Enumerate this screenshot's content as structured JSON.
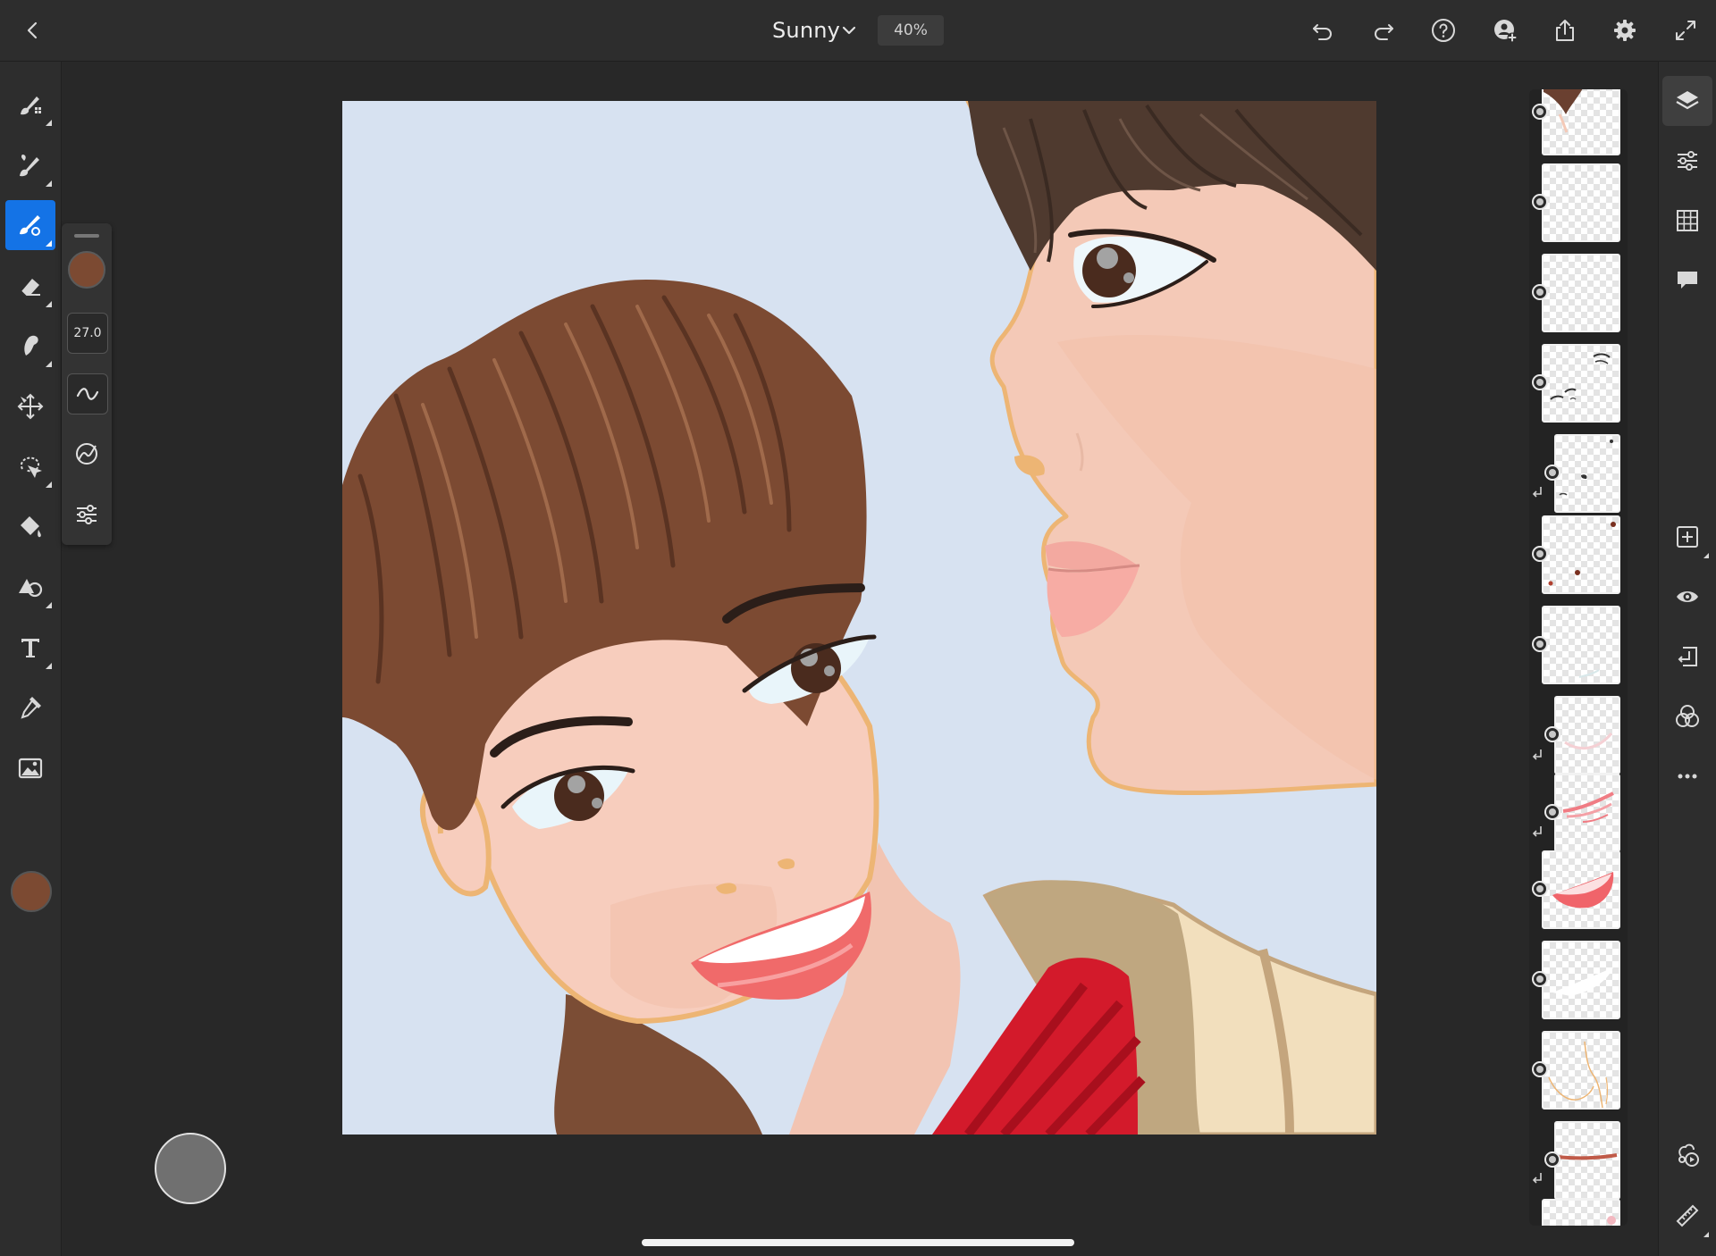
{
  "document": {
    "title": "Sunny",
    "zoom": "40%"
  },
  "topbar": {
    "left_icons": [
      "back-chevron-icon"
    ],
    "title_dropdown_icon": "chevron-down-icon",
    "right_icons": [
      "undo-icon",
      "redo-icon",
      "help-icon",
      "invite-user-icon",
      "share-icon",
      "settings-gear-icon",
      "fullscreen-icon"
    ]
  },
  "left_toolbar": {
    "tools": [
      {
        "id": "pixel-brush",
        "icon": "pixel-brush-icon",
        "active": false
      },
      {
        "id": "live-brush",
        "icon": "live-brush-icon",
        "active": false
      },
      {
        "id": "vector-brush",
        "icon": "vector-brush-icon",
        "active": true
      },
      {
        "id": "eraser",
        "icon": "eraser-icon",
        "active": false
      },
      {
        "id": "smudge",
        "icon": "smudge-icon",
        "active": false
      },
      {
        "id": "transform",
        "icon": "transform-move-icon",
        "active": false
      },
      {
        "id": "lasso-selection",
        "icon": "lasso-icon",
        "active": false
      },
      {
        "id": "fill",
        "icon": "paint-bucket-icon",
        "active": false
      },
      {
        "id": "shapes",
        "icon": "shapes-icon",
        "active": false
      },
      {
        "id": "text",
        "icon": "text-icon",
        "active": false
      },
      {
        "id": "eyedropper",
        "icon": "eyedropper-icon",
        "active": false
      },
      {
        "id": "place-image",
        "icon": "image-icon",
        "active": false
      }
    ],
    "current_color": "#7c4a32"
  },
  "brush_flyout": {
    "color": "#7c4a32",
    "size_value": "27.0",
    "items": [
      "brush-color-swatch",
      "brush-size-field",
      "smoothing-icon",
      "pressure-icon",
      "brush-settings-icon"
    ]
  },
  "right_toolbar": {
    "tools": [
      {
        "id": "layers",
        "icon": "layers-icon",
        "active": true
      },
      {
        "id": "layer-properties",
        "icon": "sliders-icon",
        "active": false
      },
      {
        "id": "grid",
        "icon": "grid-icon",
        "active": false
      },
      {
        "id": "comments",
        "icon": "comment-icon",
        "active": false
      },
      {
        "id": "add-layer",
        "icon": "add-layer-icon",
        "active": false
      },
      {
        "id": "visibility",
        "icon": "eye-icon",
        "active": false
      },
      {
        "id": "merge-down",
        "icon": "merge-down-icon",
        "active": false
      },
      {
        "id": "blend-mode",
        "icon": "blend-mode-icon",
        "active": false
      },
      {
        "id": "more",
        "icon": "more-horizontal-icon",
        "active": false
      },
      {
        "id": "timelapse",
        "icon": "timelapse-icon",
        "active": false
      },
      {
        "id": "ruler",
        "icon": "ruler-icon",
        "active": false
      }
    ]
  },
  "layers": [
    {
      "content": "hair-top",
      "clipped": false
    },
    {
      "content": "empty",
      "clipped": false
    },
    {
      "content": "empty",
      "clipped": false
    },
    {
      "content": "eye-lines",
      "clipped": false
    },
    {
      "content": "small-marks",
      "clipped": true
    },
    {
      "content": "dots",
      "clipped": false
    },
    {
      "content": "empty",
      "clipped": false
    },
    {
      "content": "faint-pink",
      "clipped": true
    },
    {
      "content": "pink-strokes",
      "clipped": true
    },
    {
      "content": "lips",
      "clipped": false
    },
    {
      "content": "white-stroke",
      "clipped": false
    },
    {
      "content": "outline",
      "clipped": false
    },
    {
      "content": "brown-stroke",
      "clipped": true
    },
    {
      "content": "partial",
      "clipped": false
    }
  ]
}
